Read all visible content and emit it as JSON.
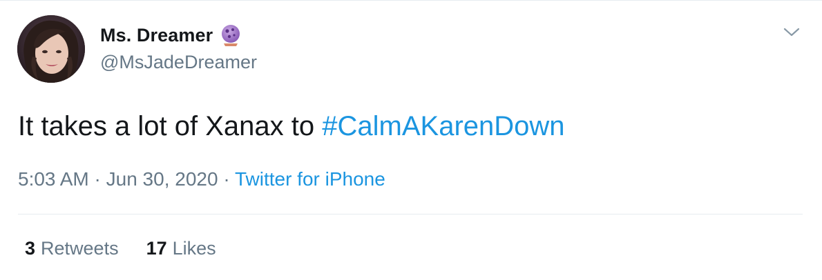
{
  "user": {
    "display_name": "Ms. Dreamer",
    "handle": "@MsJadeDreamer",
    "badge_icon": "crystal-ball-icon"
  },
  "tweet": {
    "text_prefix": "It takes a lot of Xanax to ",
    "hashtag": "#CalmAKarenDown"
  },
  "meta": {
    "time": "5:03 AM",
    "separator_1": " · ",
    "date": "Jun 30, 2020",
    "separator_2": " · ",
    "source": "Twitter for iPhone"
  },
  "stats": {
    "retweets_count": "3",
    "retweets_label": "Retweets",
    "likes_count": "17",
    "likes_label": "Likes"
  },
  "icons": {
    "menu": "chevron-down-icon"
  },
  "colors": {
    "link": "#1b95e0",
    "secondary_text": "#657786",
    "primary_text": "#14171a",
    "divider": "#e6ecf0"
  }
}
